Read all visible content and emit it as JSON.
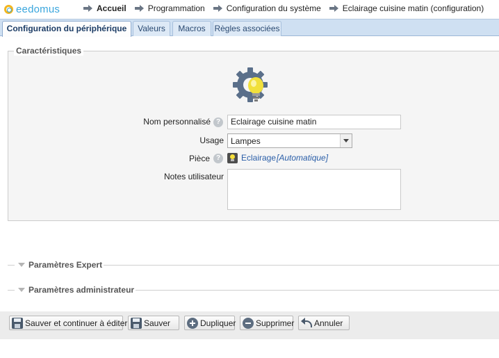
{
  "header": {
    "logo_text": "eedomus",
    "breadcrumbs": [
      {
        "label": "Accueil"
      },
      {
        "label": "Programmation"
      },
      {
        "label": "Configuration du système"
      },
      {
        "label": "Eclairage cuisine matin (configuration)"
      }
    ]
  },
  "tabs": [
    {
      "label": "Configuration du périphérique",
      "active": true
    },
    {
      "label": "Valeurs"
    },
    {
      "label": "Macros"
    },
    {
      "label": "Règles associées"
    }
  ],
  "characteristics": {
    "legend": "Caractéristiques",
    "device_icon": "gear-lightbulb-icon",
    "name_label": "Nom personnalisé",
    "name_value": "Eclairage cuisine matin",
    "usage_label": "Usage",
    "usage_value": "Lampes",
    "room_label": "Pièce",
    "room_value": "Eclairage",
    "room_mode": "[Automatique]",
    "notes_label": "Notes utilisateur",
    "notes_value": "",
    "help_symbol": "?"
  },
  "sections": {
    "expert": "Paramètres Expert",
    "admin": "Paramètres administrateur"
  },
  "buttons": {
    "save_continue": "Sauver et continuer à éditer",
    "save": "Sauver",
    "duplicate": "Dupliquer",
    "delete": "Supprimer",
    "cancel": "Annuler"
  },
  "colors": {
    "tab_bar": "#cfe0f2",
    "link": "#2a5ea8",
    "logo": "#3aa6dd"
  }
}
